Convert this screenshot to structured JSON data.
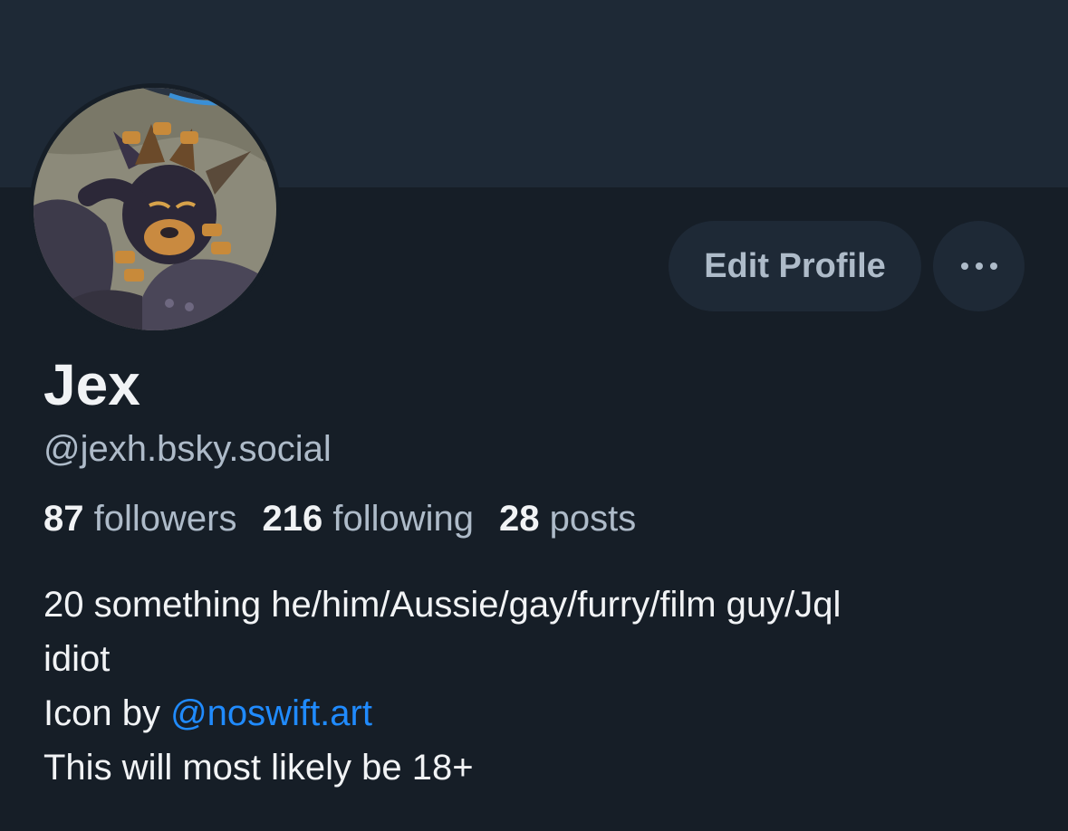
{
  "profile": {
    "display_name": "Jex",
    "handle": "@jexh.bsky.social",
    "avatar_icon": "profile-avatar-illustration"
  },
  "actions": {
    "edit_profile_label": "Edit Profile",
    "more_icon": "ellipsis-icon"
  },
  "stats": {
    "followers_count": "87",
    "followers_label": "followers",
    "following_count": "216",
    "following_label": "following",
    "posts_count": "28",
    "posts_label": "posts"
  },
  "bio": {
    "line1": "20 something he/him/Aussie/gay/furry/film guy/Jql",
    "line2": "idiot",
    "line3_prefix": "Icon by ",
    "line3_link": "@noswift.art",
    "line4": "This will most likely be 18+"
  },
  "colors": {
    "background": "#161e27",
    "banner": "#1e2936",
    "button_bg": "#1e2936",
    "text_primary": "#f1f3f5",
    "text_secondary": "#aebbc9",
    "link": "#208bfe"
  }
}
